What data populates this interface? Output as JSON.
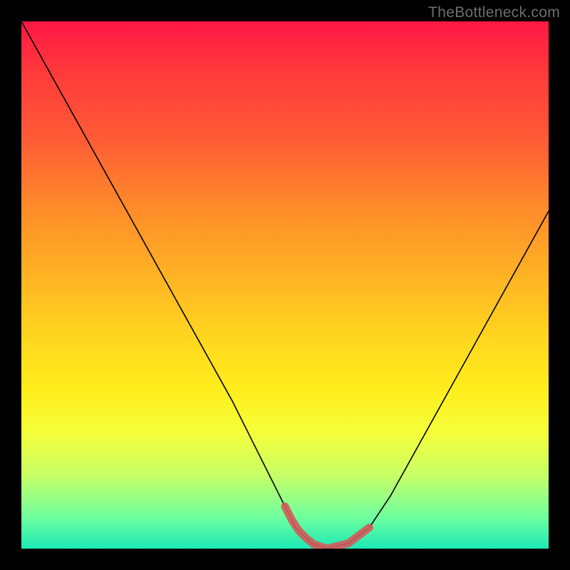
{
  "watermark": "TheBottleneck.com",
  "chart_data": {
    "type": "line",
    "title": "",
    "xlabel": "",
    "ylabel": "",
    "xlim": [
      0,
      100
    ],
    "ylim": [
      0,
      100
    ],
    "grid": false,
    "legend": false,
    "series": [
      {
        "name": "bottleneck-curve",
        "x": [
          0,
          10,
          20,
          30,
          40,
          48,
          52,
          55,
          58,
          62,
          66,
          70,
          80,
          90,
          100
        ],
        "y": [
          100,
          82,
          64,
          46,
          28,
          12,
          4,
          1,
          0,
          1,
          4,
          10,
          28,
          46,
          64
        ]
      }
    ],
    "annotations": [
      {
        "name": "optimal-band",
        "type": "highlight-segment",
        "x_range": [
          50,
          66
        ],
        "color": "#d45a5a"
      }
    ]
  }
}
